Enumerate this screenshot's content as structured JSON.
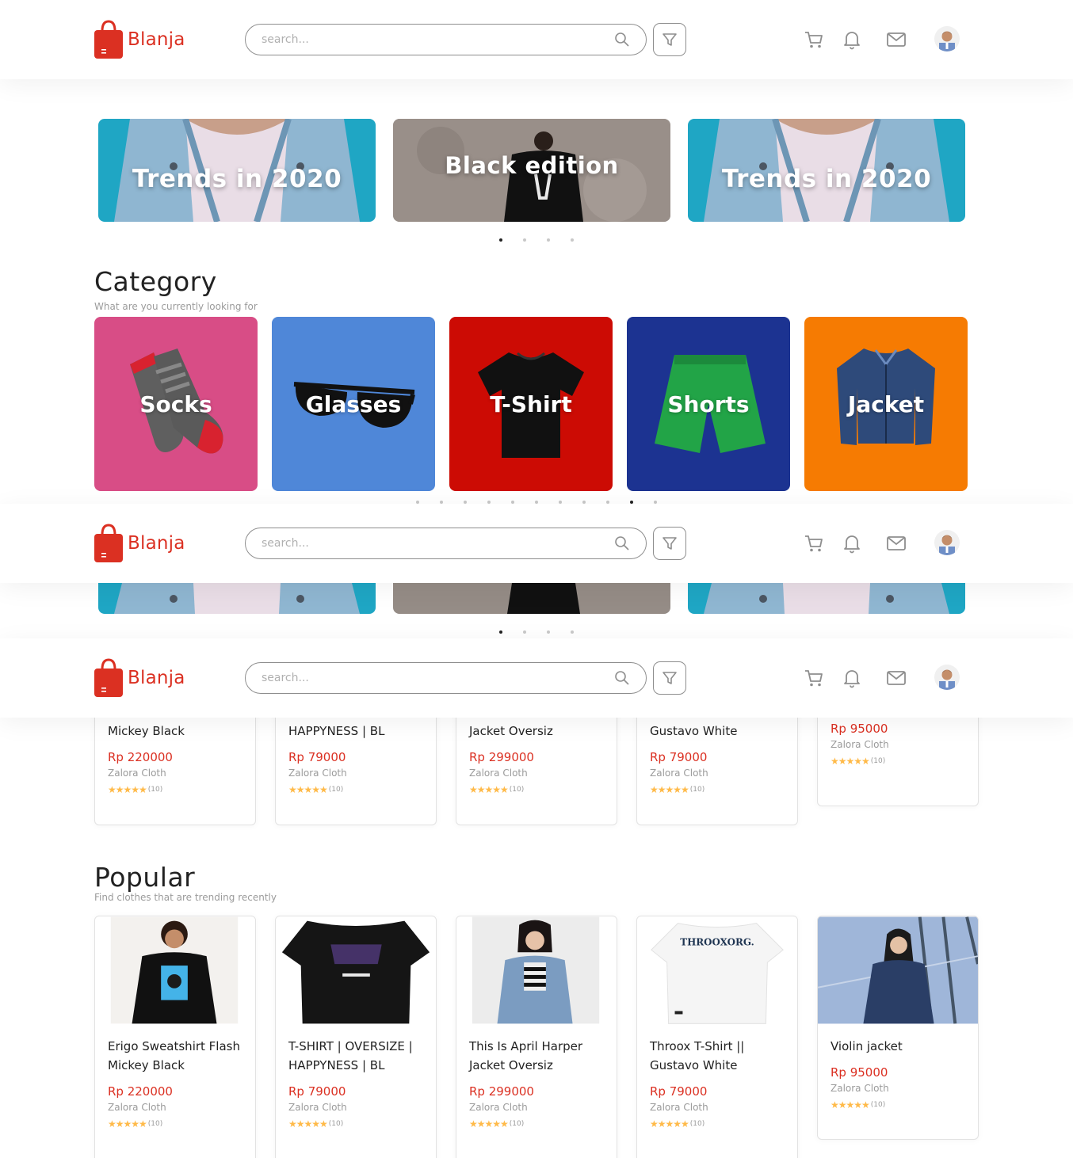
{
  "brand": {
    "name": "Blanja",
    "color": "#DB3022"
  },
  "search": {
    "placeholder": "search..."
  },
  "icons": [
    "search-icon",
    "filter-icon",
    "cart-icon",
    "bell-icon",
    "mail-icon"
  ],
  "banners": [
    {
      "title": "Trends in 2020"
    },
    {
      "title": "Black edition"
    },
    {
      "title": "Trends in 2020"
    }
  ],
  "category": {
    "title": "Category",
    "subtitle": "What are you currently looking for",
    "items": [
      {
        "label": "Socks",
        "color": "#D84D86"
      },
      {
        "label": "Glasses",
        "color": "#4F87D8"
      },
      {
        "label": "T-Shirt",
        "color": "#CC0B04"
      },
      {
        "label": "Shorts",
        "color": "#1C3391"
      },
      {
        "label": "Jacket",
        "color": "#F67B02"
      }
    ]
  },
  "new_products": [
    {
      "name_line2": "Mickey Black",
      "price": "Rp 220000",
      "store": "Zalora Cloth",
      "rating": "(10)"
    },
    {
      "name_line2": "HAPPYNESS | BL",
      "price": "Rp 79000",
      "store": "Zalora Cloth",
      "rating": "(10)"
    },
    {
      "name_line2": "Jacket Oversiz",
      "price": "Rp 299000",
      "store": "Zalora Cloth",
      "rating": "(10)"
    },
    {
      "name_line2": "Gustavo White",
      "price": "Rp 79000",
      "store": "Zalora Cloth",
      "rating": "(10)"
    },
    {
      "name_line2": "",
      "price": "Rp 95000",
      "store": "Zalora Cloth",
      "rating": "(10)"
    }
  ],
  "popular": {
    "title": "Popular",
    "subtitle": "Find clothes that are trending recently",
    "products": [
      {
        "name": "Erigo Sweatshirt Flash Mickey Black",
        "price": "Rp 220000",
        "store": "Zalora Cloth",
        "rating": "(10)"
      },
      {
        "name": "T-SHIRT | OVERSIZE | HAPPYNESS | BL",
        "price": "Rp 79000",
        "store": "Zalora Cloth",
        "rating": "(10)"
      },
      {
        "name": "This Is April Harper Jacket Oversiz",
        "price": "Rp 299000",
        "store": "Zalora Cloth",
        "rating": "(10)"
      },
      {
        "name": "Throox T-Shirt || Gustavo White",
        "price": "Rp 79000",
        "store": "Zalora Cloth",
        "rating": "(10)"
      },
      {
        "name": "Violin jacket",
        "price": "Rp 95000",
        "store": "Zalora Cloth",
        "rating": "(10)"
      }
    ]
  },
  "stars": "★★★★★",
  "throox_print": "THROOXORG."
}
